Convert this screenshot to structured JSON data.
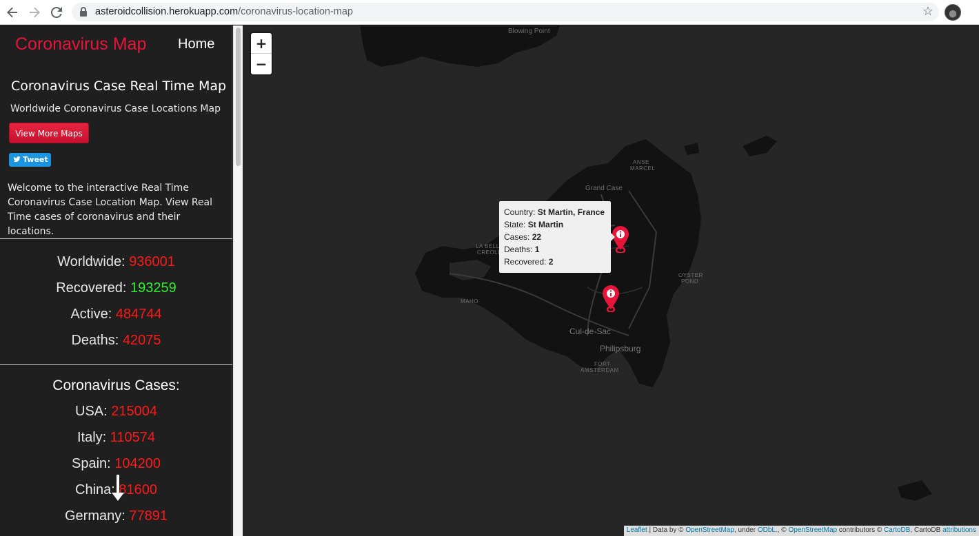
{
  "browser": {
    "url_host": "asteroidcollision.herokuapp.com",
    "url_path": "/coronavirus-location-map",
    "icons": [
      "back-arrow-icon",
      "forward-arrow-icon",
      "reload-icon",
      "lock-icon",
      "star-icon",
      "profile-avatar"
    ]
  },
  "sidebar": {
    "brand": "Coronavirus Map",
    "home": "Home",
    "title": "Coronavirus Case Real Time Map",
    "subtitle": "Worldwide Coronavirus Case Locations Map",
    "view_more_button": "View More Maps",
    "tweet_button": "Tweet",
    "welcome": "Welcome to the interactive Real Time Coronavirus Case Location Map. View Real Time cases of coronavirus and their locations.",
    "stats": [
      {
        "label": "Worldwide:",
        "value": "936001",
        "color": "#ff1a1a"
      },
      {
        "label": "Recovered:",
        "value": "193259",
        "color": "#2ef02e"
      },
      {
        "label": "Active:",
        "value": "484744",
        "color": "#ff1a1a"
      },
      {
        "label": "Deaths:",
        "value": "42075",
        "color": "#ff1a1a"
      }
    ],
    "cases_heading": "Coronavirus Cases:",
    "countries": [
      {
        "label": "USA:",
        "value": "215004"
      },
      {
        "label": "Italy:",
        "value": "110574"
      },
      {
        "label": "Spain:",
        "value": "104200"
      },
      {
        "label": "China:",
        "value": "81600"
      },
      {
        "label": "Germany:",
        "value": "77891"
      }
    ]
  },
  "map": {
    "zoom_in": "+",
    "zoom_out": "−",
    "places": {
      "blowing_point": "Blowing Point",
      "anse": "ANSE",
      "marcel": "MARCEL",
      "grand_case": "Grand Case",
      "la_belle": "LA BELLE",
      "creole": "CREOLE",
      "oyster": "OYSTER",
      "pond": "POND",
      "mano": "MAHO",
      "cul_de_sac": "Cul-de-Sac",
      "philipsburg": "Philipsburg",
      "fort": "FORT",
      "amsterdam": "AMSTERDAM"
    },
    "popup": {
      "country_label": "Country:",
      "country_value": "St Martin, France",
      "state_label": "State:",
      "state_value": "St Martin",
      "cases_label": "Cases:",
      "cases_value": "22",
      "deaths_label": "Deaths:",
      "deaths_value": "1",
      "recovered_label": "Recovered:",
      "recovered_value": "2"
    },
    "attribution": {
      "leaflet": "Leaflet",
      "data_by": " | Data by © ",
      "osm1": "OpenStreetMap",
      "under": ", under ",
      "odbl": "ODbL.",
      "sep": ", © ",
      "osm2": "OpenStreetMap",
      "contributors": " contributors © ",
      "cartodb": "CartoDB",
      "cartodb_attr": ", CartoDB ",
      "attributions": "attributions"
    },
    "accent": "#e8153a"
  }
}
